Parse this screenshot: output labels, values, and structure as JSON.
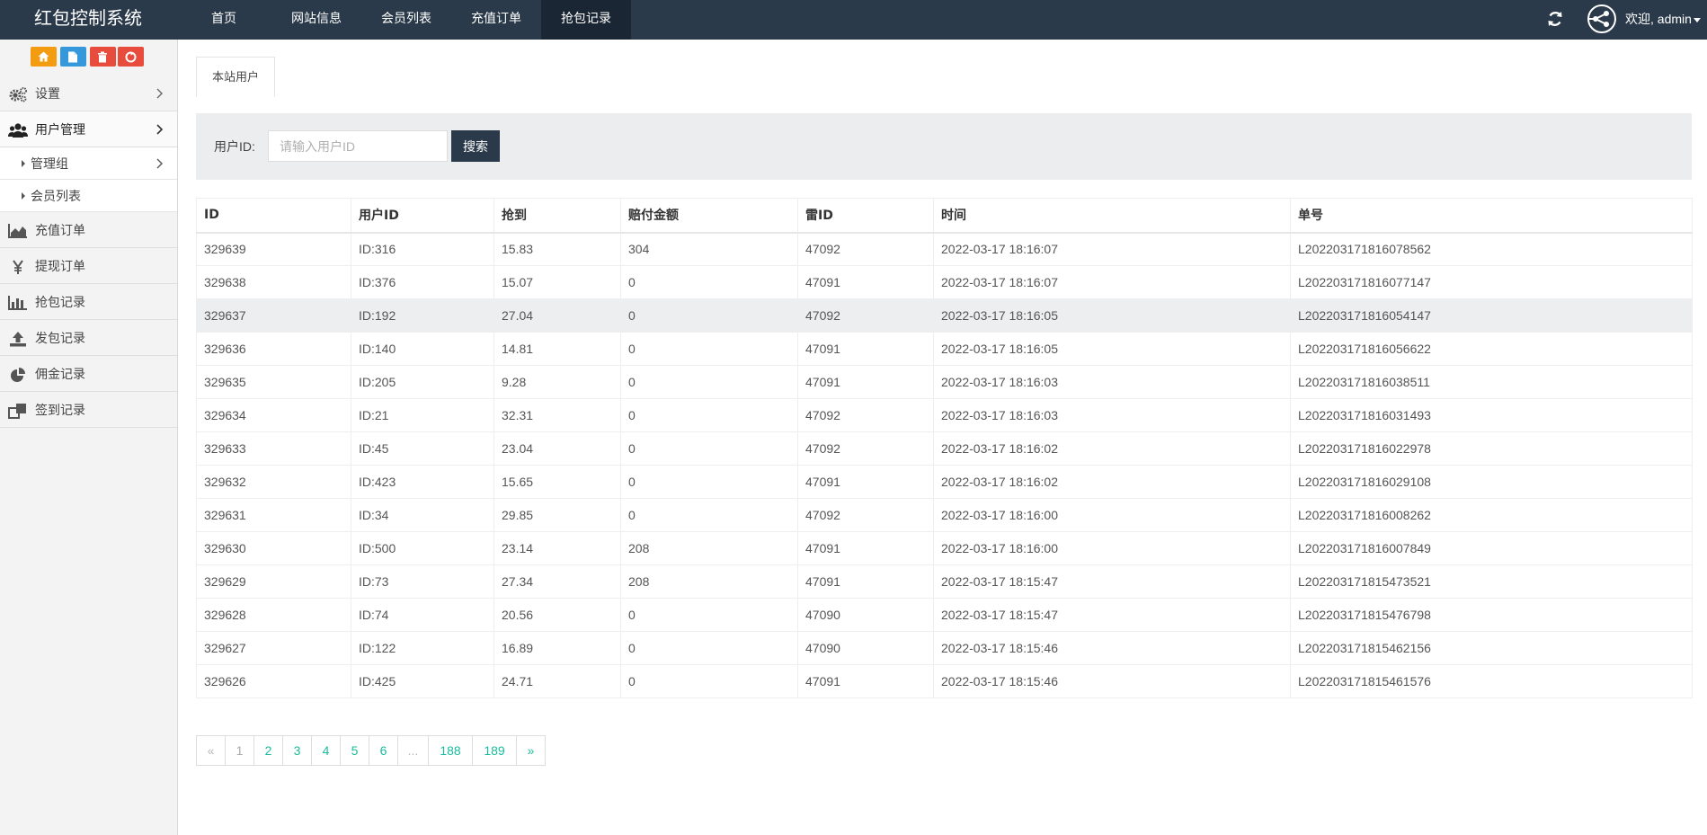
{
  "app": {
    "title": "红包控制系统",
    "welcome": "欢迎, admin"
  },
  "topnav": [
    {
      "label": "首页",
      "active": false
    },
    {
      "label": "网站信息",
      "active": false
    },
    {
      "label": "会员列表",
      "active": false
    },
    {
      "label": "充值订单",
      "active": false
    },
    {
      "label": "抢包记录",
      "active": true
    }
  ],
  "shortcuts": [
    {
      "icon": "home-icon",
      "color": "#f39c12"
    },
    {
      "icon": "file-icon",
      "color": "#3498db"
    },
    {
      "icon": "trash-icon",
      "color": "#e74c3c"
    },
    {
      "icon": "recycle-icon",
      "color": "#e74c3c"
    }
  ],
  "sidebar": {
    "items": [
      {
        "label": "设置",
        "icon": "gears-icon"
      },
      {
        "label": "用户管理",
        "icon": "users-icon"
      },
      {
        "label": "充值订单",
        "icon": "area-chart-icon"
      },
      {
        "label": "提现订单",
        "icon": "yen-icon"
      },
      {
        "label": "抢包记录",
        "icon": "bar-chart-icon"
      },
      {
        "label": "发包记录",
        "icon": "upload-icon"
      },
      {
        "label": "佣金记录",
        "icon": "pie-chart-icon"
      },
      {
        "label": "签到记录",
        "icon": "clone-icon"
      }
    ],
    "subitems": [
      {
        "label": "管理组"
      },
      {
        "label": "会员列表"
      }
    ]
  },
  "tab": {
    "label": "本站用户"
  },
  "search": {
    "label": "用户ID:",
    "placeholder": "请输入用户ID",
    "value": "",
    "button": "搜索"
  },
  "table": {
    "columns": [
      "ID",
      "用户ID",
      "抢到",
      "赔付金额",
      "雷ID",
      "时间",
      "单号"
    ],
    "rows": [
      [
        "329639",
        "ID:316",
        "15.83",
        "304",
        "47092",
        "2022-03-17 18:16:07",
        "L202203171816078562"
      ],
      [
        "329638",
        "ID:376",
        "15.07",
        "0",
        "47091",
        "2022-03-17 18:16:07",
        "L202203171816077147"
      ],
      [
        "329637",
        "ID:192",
        "27.04",
        "0",
        "47092",
        "2022-03-17 18:16:05",
        "L202203171816054147"
      ],
      [
        "329636",
        "ID:140",
        "14.81",
        "0",
        "47091",
        "2022-03-17 18:16:05",
        "L202203171816056622"
      ],
      [
        "329635",
        "ID:205",
        "9.28",
        "0",
        "47091",
        "2022-03-17 18:16:03",
        "L202203171816038511"
      ],
      [
        "329634",
        "ID:21",
        "32.31",
        "0",
        "47092",
        "2022-03-17 18:16:03",
        "L202203171816031493"
      ],
      [
        "329633",
        "ID:45",
        "23.04",
        "0",
        "47092",
        "2022-03-17 18:16:02",
        "L202203171816022978"
      ],
      [
        "329632",
        "ID:423",
        "15.65",
        "0",
        "47091",
        "2022-03-17 18:16:02",
        "L202203171816029108"
      ],
      [
        "329631",
        "ID:34",
        "29.85",
        "0",
        "47092",
        "2022-03-17 18:16:00",
        "L202203171816008262"
      ],
      [
        "329630",
        "ID:500",
        "23.14",
        "208",
        "47091",
        "2022-03-17 18:16:00",
        "L202203171816007849"
      ],
      [
        "329629",
        "ID:73",
        "27.34",
        "208",
        "47091",
        "2022-03-17 18:15:47",
        "L202203171815473521"
      ],
      [
        "329628",
        "ID:74",
        "20.56",
        "0",
        "47090",
        "2022-03-17 18:15:47",
        "L202203171815476798"
      ],
      [
        "329627",
        "ID:122",
        "16.89",
        "0",
        "47090",
        "2022-03-17 18:15:46",
        "L202203171815462156"
      ],
      [
        "329626",
        "ID:425",
        "24.71",
        "0",
        "47091",
        "2022-03-17 18:15:46",
        "L202203171815461576"
      ]
    ]
  },
  "pagination": {
    "pages": [
      "«",
      "1",
      "2",
      "3",
      "4",
      "5",
      "6",
      "...",
      "188",
      "189",
      "»"
    ],
    "current": "1"
  }
}
